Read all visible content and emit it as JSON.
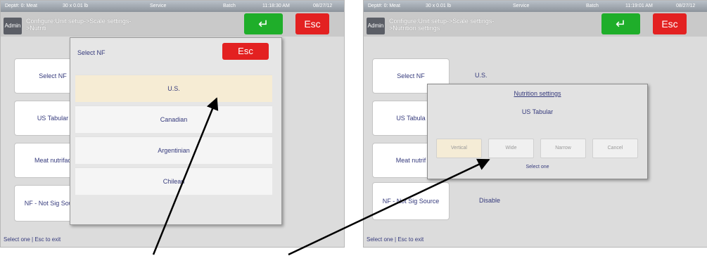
{
  "left": {
    "status": {
      "dept": "Dept#: 0: Meat",
      "unit": "30 x 0.01 lb",
      "mode": "Service",
      "batch": "Batch",
      "time": "11:18:30 AM",
      "date": "08/27/12"
    },
    "admin_label": "Admin",
    "path_line1": "Configure:Unit setup->Scale settings-",
    "path_line2": ">Nutriti",
    "enter_symbol": "↵",
    "esc_label": "Esc",
    "side_buttons": [
      "Select NF",
      "US Tabular",
      "Meat nutrifac",
      "NF - Not Sig Source"
    ],
    "footer": "Select one | Esc to exit",
    "dialog": {
      "title": "Select NF",
      "esc_label": "Esc",
      "options": [
        "U.S.",
        "Canadian",
        "Argentinian",
        "Chilean"
      ]
    }
  },
  "right": {
    "status": {
      "dept": "Dept#: 0: Meat",
      "unit": "30 x 0.01 lb",
      "mode": "Service",
      "batch": "Batch",
      "time": "11:19:01 AM",
      "date": "08/27/12"
    },
    "admin_label": "Admin",
    "path_line1": "Configure:Unit setup->Scale settings-",
    "path_line2": ">Nutrition settings",
    "enter_symbol": "↵",
    "esc_label": "Esc",
    "side_buttons": [
      "Select NF",
      "US Tabula",
      "Meat nutrif",
      "NF - Not Sig Source"
    ],
    "values": {
      "select_nf": "U.S.",
      "nf_not_sig": "Disable"
    },
    "footer": "Select one | Esc to exit",
    "dialog": {
      "title": "Nutrition settings",
      "subtitle": "US Tabular",
      "buttons": [
        "Vertical",
        "Wide",
        "Narrow",
        "Cancel"
      ],
      "hint": "Select one"
    }
  },
  "colors": {
    "accent_green": "#1fae2a",
    "accent_red": "#e32121",
    "text_navy": "#353a7c",
    "selected_option": "#f6ecd4"
  }
}
